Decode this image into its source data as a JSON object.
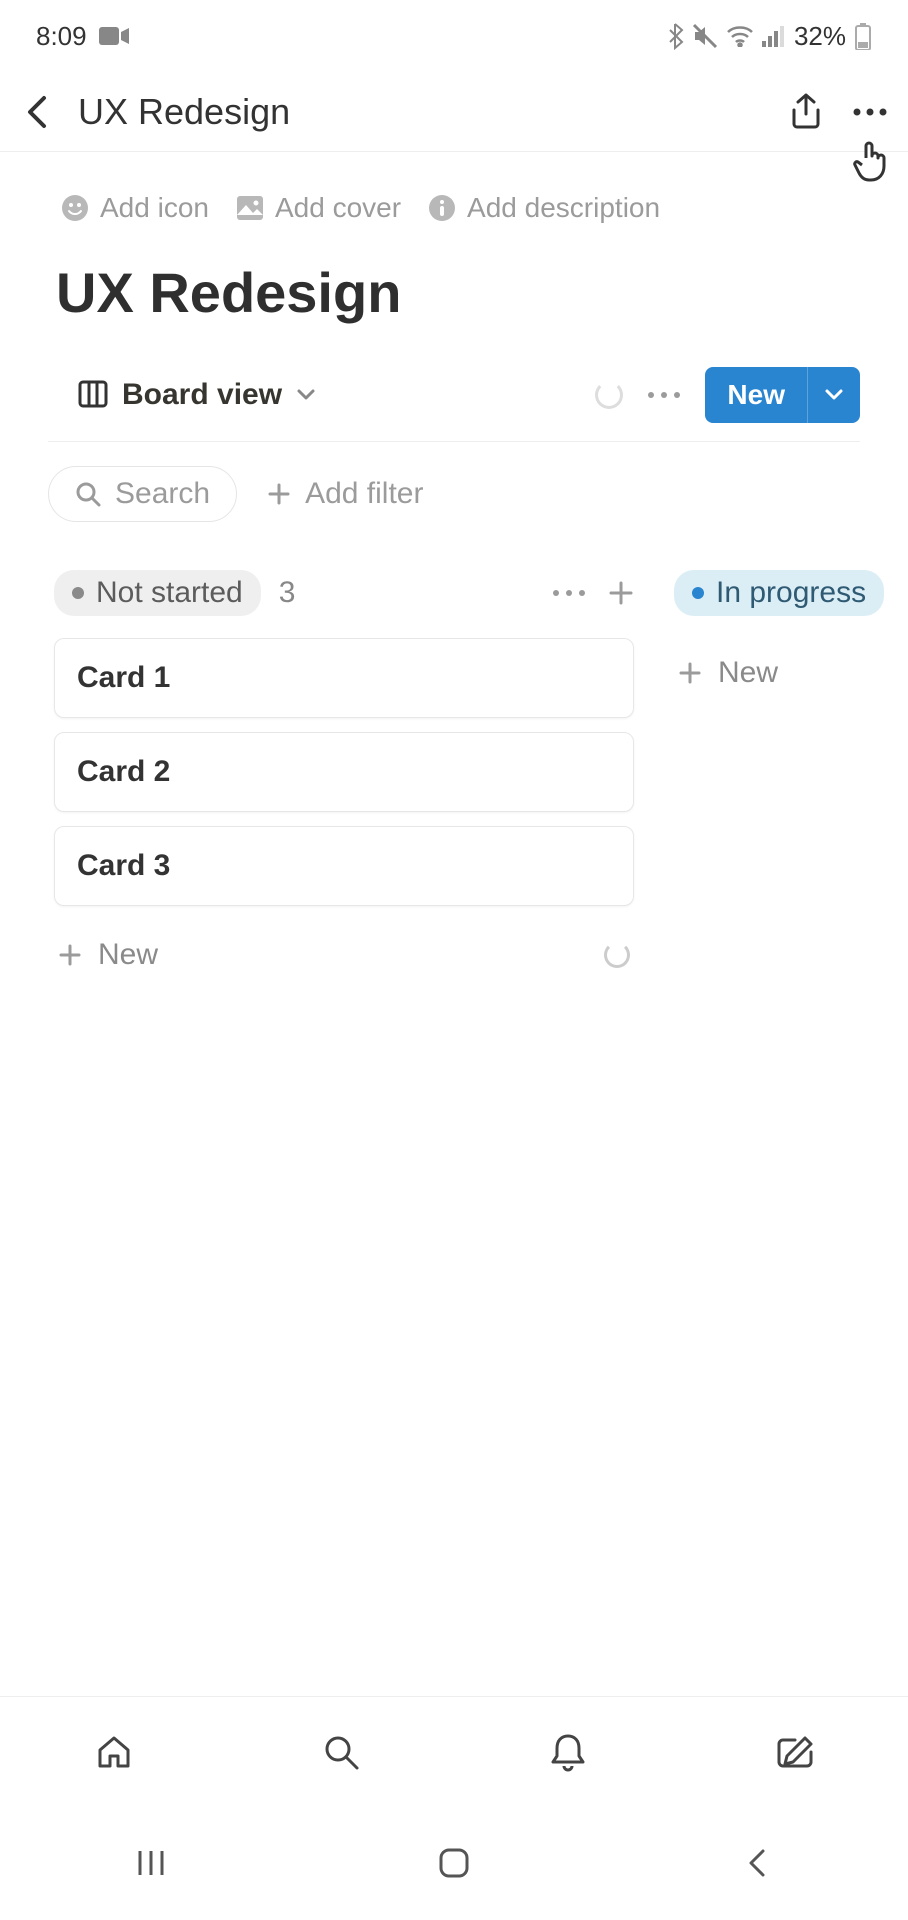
{
  "status_bar": {
    "time": "8:09",
    "battery_pct": "32%"
  },
  "header": {
    "title": "UX Redesign"
  },
  "page_options": {
    "add_icon": "Add icon",
    "add_cover": "Add cover",
    "add_description": "Add description"
  },
  "page": {
    "title": "UX Redesign"
  },
  "view": {
    "name": "Board view",
    "new_button": "New"
  },
  "toolbar": {
    "search_label": "Search",
    "add_filter": "Add filter"
  },
  "board": {
    "columns": [
      {
        "name": "Not started",
        "count": "3",
        "chip": "grey",
        "cards": [
          "Card 1",
          "Card 2",
          "Card 3"
        ],
        "new_label": "New"
      },
      {
        "name": "In progress",
        "chip": "blue",
        "count": "",
        "cards": [],
        "new_label": "New"
      }
    ]
  }
}
